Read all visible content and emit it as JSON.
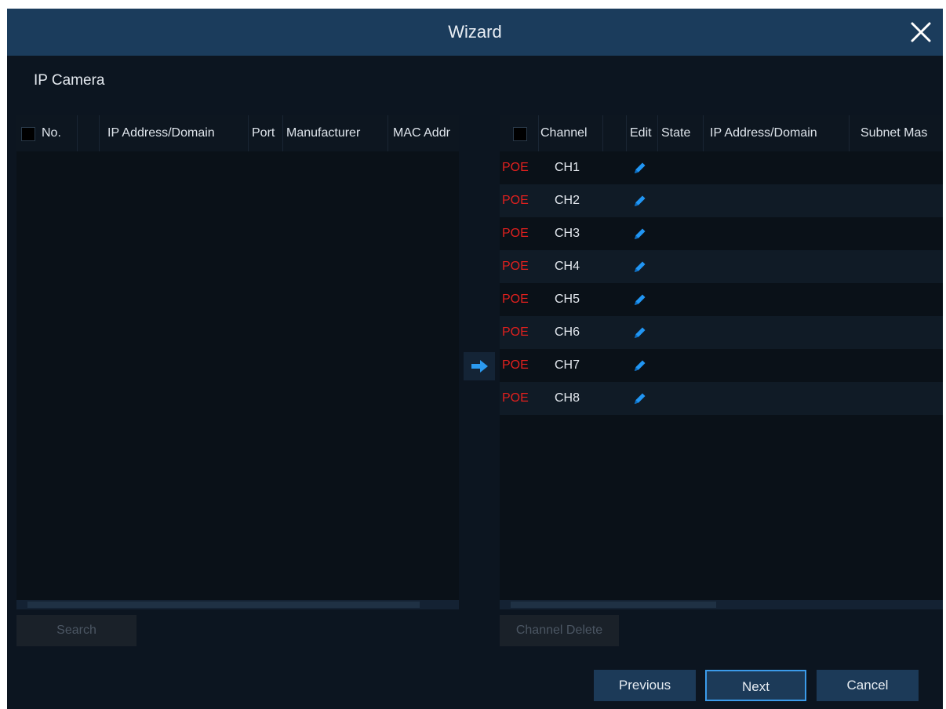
{
  "window": {
    "title": "Wizard"
  },
  "section_title": "IP Camera",
  "left_table": {
    "columns": [
      "No.",
      "IP Address/Domain",
      "Port",
      "Manufacturer",
      "MAC Addr"
    ]
  },
  "right_table": {
    "columns": [
      "Channel",
      "Edit",
      "State",
      "IP Address/Domain",
      "Subnet Mas"
    ],
    "rows": [
      {
        "state": "POE",
        "channel": "CH1"
      },
      {
        "state": "POE",
        "channel": "CH2"
      },
      {
        "state": "POE",
        "channel": "CH3"
      },
      {
        "state": "POE",
        "channel": "CH4"
      },
      {
        "state": "POE",
        "channel": "CH5"
      },
      {
        "state": "POE",
        "channel": "CH6"
      },
      {
        "state": "POE",
        "channel": "CH7"
      },
      {
        "state": "POE",
        "channel": "CH8"
      }
    ]
  },
  "buttons": {
    "search": "Search",
    "channel_delete": "Channel Delete",
    "previous": "Previous",
    "next": "Next",
    "cancel": "Cancel"
  },
  "icons": {
    "close": "close-icon",
    "edit": "pencil-icon",
    "add": "arrow-right-icon"
  },
  "colors": {
    "titlebar": "#1b3c5c",
    "background": "#0c1520",
    "poe": "#e0201e",
    "accent": "#2196f3"
  }
}
